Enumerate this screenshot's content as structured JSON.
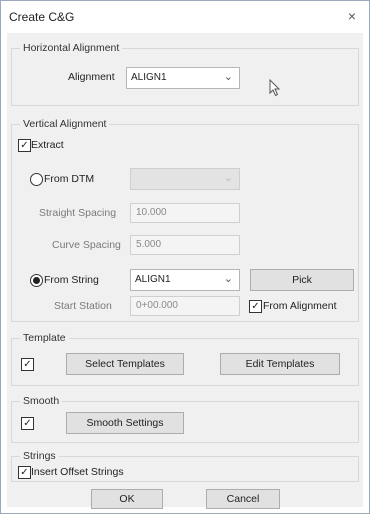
{
  "window": {
    "title": "Create C&G",
    "close_glyph": "×"
  },
  "horizontal": {
    "group_title": "Horizontal Alignment",
    "alignment_label": "Alignment",
    "alignment_value": "ALIGN1"
  },
  "vertical": {
    "group_title": "Vertical Alignment",
    "extract_label": "Extract",
    "extract_checked": true,
    "from_dtm_label": "From DTM",
    "straight_spacing_label": "Straight Spacing",
    "straight_spacing_value": "10.000",
    "curve_spacing_label": "Curve Spacing",
    "curve_spacing_value": "5.000",
    "from_string_label": "From String",
    "from_string_value": "ALIGN1",
    "pick_label": "Pick",
    "start_station_label": "Start Station",
    "start_station_value": "0+00.000",
    "from_alignment_label": "From Alignment",
    "from_alignment_checked": true
  },
  "template": {
    "group_title": "Template",
    "select_label": "Select Templates",
    "edit_label": "Edit Templates"
  },
  "smooth": {
    "group_title": "Smooth",
    "settings_label": "Smooth Settings"
  },
  "strings": {
    "group_title": "Strings",
    "insert_offset_label": "Insert Offset Strings"
  },
  "footer": {
    "ok_label": "OK",
    "cancel_label": "Cancel"
  }
}
